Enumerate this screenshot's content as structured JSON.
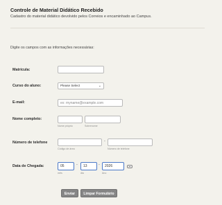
{
  "header": {
    "title": "Controle de Material Didático Recebido",
    "subtitle": "Cadastro do material didático devolvido pelos Correios e encaminhado ao Campus."
  },
  "intro": "Digite os campos com as informações necessárias:",
  "form": {
    "matricula": {
      "label": "Matrícula:",
      "value": ""
    },
    "curso": {
      "label": "Curso do aluno:",
      "selected": "Please Select"
    },
    "email": {
      "label": "E-mail:",
      "placeholder": "ex: myname@example.com"
    },
    "nome": {
      "label": "Nome completo:",
      "first_sublabel": "Nome próprio",
      "last_sublabel": "Sobrenome"
    },
    "telefone": {
      "label": "Número de telefone",
      "area_sublabel": "Código de área",
      "number_sublabel": "Número de telefone",
      "separator": "-"
    },
    "data": {
      "label": "Data de Chegada:",
      "month": "05",
      "day": "13",
      "year": "2026",
      "month_sublabel": "mês",
      "day_sublabel": "dia",
      "year_sublabel": "Ano",
      "separator": "-"
    }
  },
  "buttons": {
    "submit": "Enviar",
    "clear": "Limpar Formulário"
  }
}
